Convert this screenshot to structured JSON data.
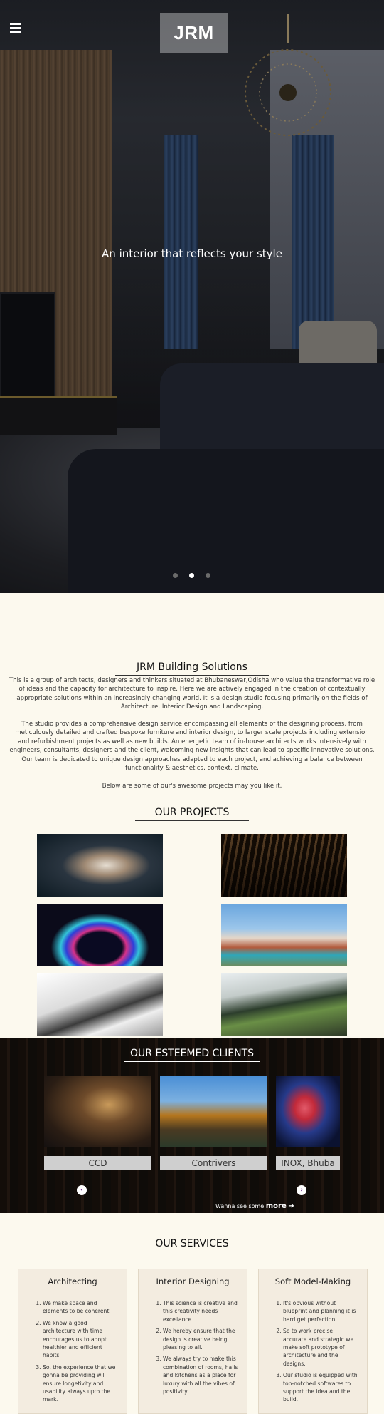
{
  "header": {
    "logo_text": "JRM",
    "tagline": "An interior that reflects your style"
  },
  "hero_slider": {
    "dot_count": 3,
    "active_index": 1
  },
  "about": {
    "title": "JRM Building Solutions",
    "paragraph1": "This is a group of architects, designers and thinkers situated at Bhubaneswar,Odisha who value the transformative role of ideas and the capacity for architecture to inspire. Here we are actively engaged in the creation of contextually appropriate solutions within an increasingly changing world. It is a design studio focusing primarily on the fields of Architecture, Interior Design and Landscaping.",
    "paragraph2": "The studio provides a comprehensive design service encompassing all elements of the designing process, from meticulously detailed and crafted bespoke furniture and interior design, to larger scale projects including extension and refurbishment projects as well as new builds. An energetic team of in-house architects works intensively with engineers, consultants, designers and the client, welcoming new insights that can lead to specific innovative solutions. Our team is dedicated to unique design approaches adapted to each project, and achieving a balance between functionality & aesthetics, context, climate.",
    "paragraph3": "Below are some of our's awesome projects may you like it."
  },
  "projects": {
    "title": "OUR PROJECTS"
  },
  "clients": {
    "title": "OUR ESTEEMED CLIENTS",
    "items": [
      {
        "name": "CCD"
      },
      {
        "name": "Contrivers"
      },
      {
        "name": "INOX, Bhuba"
      }
    ],
    "more_prefix": "Wanna see some",
    "more_label": "more"
  },
  "services": {
    "title": "OUR SERVICES",
    "cards": [
      {
        "title": "Architecting",
        "points": [
          "We make space and elements to be coherent.",
          "We know a good architecture with time encourages us to adopt healthier and efficient habits.",
          "So, the experience that we gonna be providing will ensure longetivity and usability always upto the mark."
        ]
      },
      {
        "title": "Interior Designing",
        "points": [
          "This science is creative and this creativity needs excellance.",
          "We hereby ensure that the design is creative being pleasing to all.",
          "We always try to make this combination of rooms, halls and kitchens as a place for luxury with all the vibes of positivity."
        ]
      },
      {
        "title": "Soft Model-Making",
        "points": [
          "It's obvious without blueprint and planning it is hard get perfection.",
          "So to work precise, accurate and strategic we make soft prototype of architecture and the designs.",
          "Our studio is equipped with top-notched softwares to support the idea and the build."
        ]
      }
    ]
  },
  "icons": {
    "menu": "hamburger-menu-icon",
    "prev": "chevron-left-icon",
    "next": "chevron-right-icon",
    "more": "arrow-right-icon"
  },
  "colors": {
    "page_background": "#fcf9ee",
    "card_background": "#f3ece0",
    "arrow_accent": "#6b2d8a"
  }
}
